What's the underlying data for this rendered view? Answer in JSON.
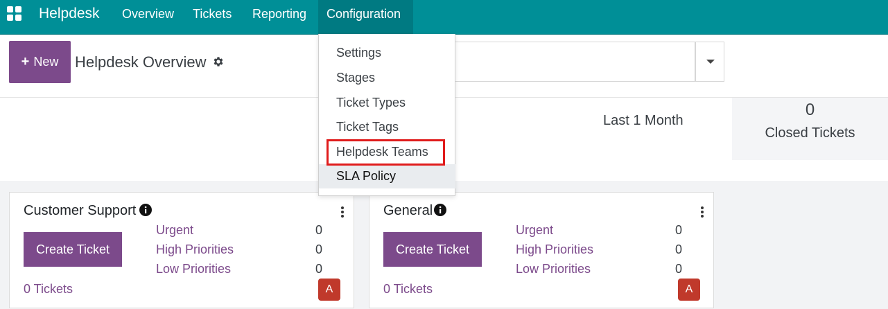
{
  "topbar": {
    "brand": "Helpdesk",
    "menu": [
      "Overview",
      "Tickets",
      "Reporting",
      "Configuration"
    ],
    "active_menu": "Configuration",
    "bg_color": "#008f97"
  },
  "control": {
    "new_button": "New",
    "page_title": "Helpdesk Overview"
  },
  "config_menu": {
    "items": [
      "Settings",
      "Stages",
      "Ticket Types",
      "Ticket Tags",
      "Helpdesk Teams",
      "SLA Policy"
    ],
    "outlined_item": "Helpdesk Teams",
    "hover_item": "SLA Policy"
  },
  "stats": {
    "period": "Last 1 Month",
    "closed_value": "0",
    "closed_label": "Closed Tickets"
  },
  "teams": [
    {
      "name": "Customer Support",
      "create_button": "Create Ticket",
      "priorities": [
        {
          "label": "Urgent",
          "count": "0"
        },
        {
          "label": "High Priorities",
          "count": "0"
        },
        {
          "label": "Low Priorities",
          "count": "0"
        }
      ],
      "tickets_link": "0 Tickets",
      "avatar": "A"
    },
    {
      "name": "General",
      "create_button": "Create Ticket",
      "priorities": [
        {
          "label": "Urgent",
          "count": "0"
        },
        {
          "label": "High Priorities",
          "count": "0"
        },
        {
          "label": "Low Priorities",
          "count": "0"
        }
      ],
      "tickets_link": "0 Tickets",
      "avatar": "A"
    }
  ],
  "colors": {
    "primary": "#7c4a8b",
    "highlight_outline": "#e01b1b",
    "avatar": "#c0392b"
  }
}
